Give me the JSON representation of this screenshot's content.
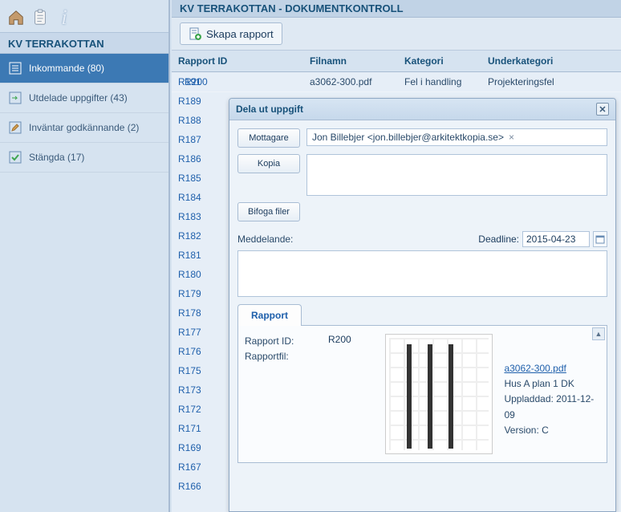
{
  "sidebar": {
    "title": "KV TERRAKOTTAN",
    "items": [
      {
        "label": "Inkommande (80)"
      },
      {
        "label": "Utdelade uppgifter (43)"
      },
      {
        "label": "Inväntar godkännande (2)"
      },
      {
        "label": "Stängda (17)"
      }
    ]
  },
  "main": {
    "title": "KV TERRAKOTTAN - DOKUMENTKONTROLL",
    "toolbar": {
      "create_label": "Skapa rapport"
    },
    "columns": {
      "id": "Rapport ID",
      "filnamn": "Filnamn",
      "kategori": "Kategori",
      "underkategori": "Underkategori"
    },
    "rows": [
      {
        "id": "R200",
        "filnamn": "a3062-300.pdf",
        "kategori": "Fel i handling",
        "underkategori": "Projekteringsfel"
      }
    ],
    "id_list": [
      "R191",
      "R189",
      "R188",
      "R187",
      "R186",
      "R185",
      "R184",
      "R183",
      "R182",
      "R181",
      "R180",
      "R179",
      "R178",
      "R177",
      "R176",
      "R175",
      "R173",
      "R172",
      "R171",
      "R169",
      "R167",
      "R166"
    ]
  },
  "dialog": {
    "title": "Dela ut uppgift",
    "buttons": {
      "mottagare": "Mottagare",
      "kopia": "Kopia",
      "bifoga": "Bifoga filer"
    },
    "recipient": "Jon Billebjer <jon.billebjer@arkitektkopia.se>",
    "meddelande_label": "Meddelande:",
    "deadline_label": "Deadline:",
    "deadline_value": "2015-04-23",
    "tab_label": "Rapport",
    "rapport": {
      "id_label": "Rapport ID:",
      "id_value": "R200",
      "fil_label": "Rapportfil:",
      "file_link": "a3062-300.pdf",
      "file_desc": "Hus A plan 1 DK",
      "file_uploaded": "Uppladdad: 2011-12-09",
      "file_version": "Version: C"
    }
  }
}
